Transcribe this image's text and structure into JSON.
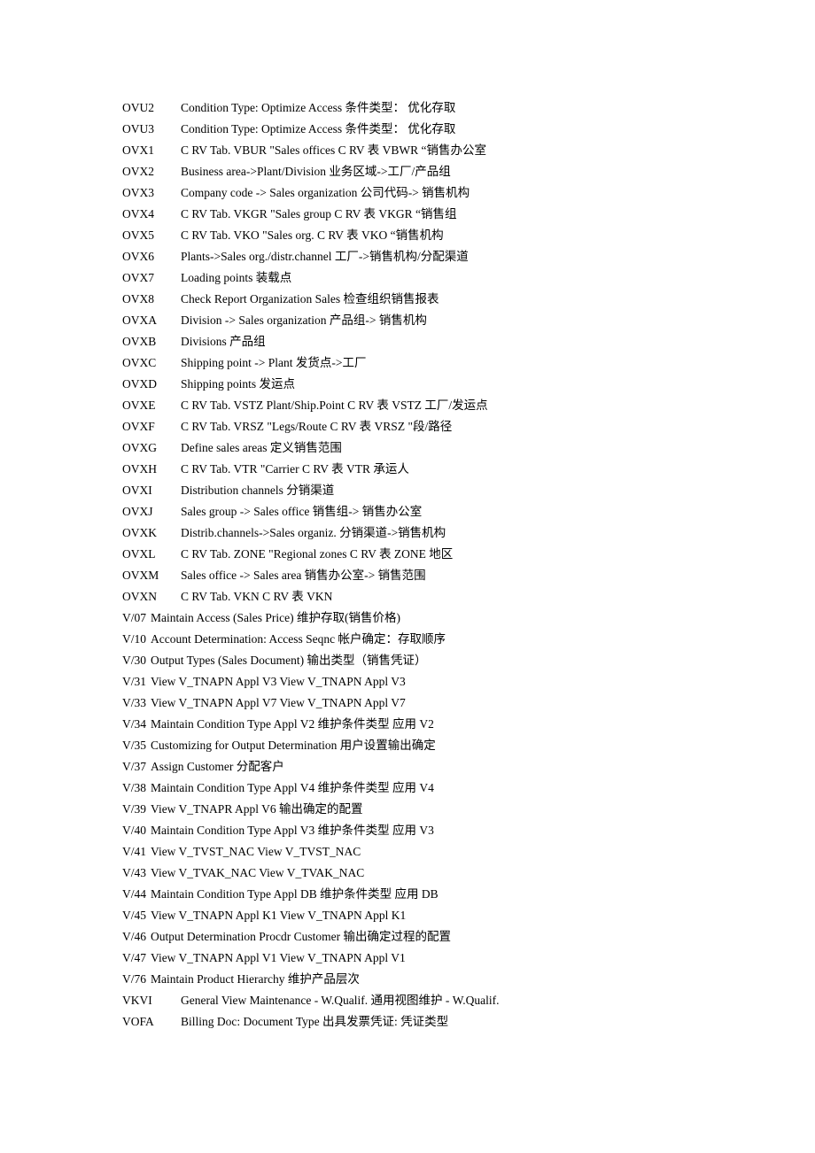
{
  "document": {
    "rows": [
      {
        "code": "OVU2",
        "desc": "Condition Type: Optimize Access  条件类型：  优化存取",
        "layout": "wide"
      },
      {
        "code": "OVU3",
        "desc": "Condition Type: Optimize Access  条件类型：  优化存取",
        "layout": "wide"
      },
      {
        "code": "OVX1",
        "desc": "C RV Tab. VBUR          \"Sales offices C RV  表  VBWR    “销售办公室",
        "layout": "wide"
      },
      {
        "code": "OVX2",
        "desc": "Business area->Plant/Division  业务区域->工厂/产品组",
        "layout": "wide"
      },
      {
        "code": "OVX3",
        "desc": "Company code -> Sales organization  公司代码->  销售机构",
        "layout": "wide"
      },
      {
        "code": "OVX4",
        "desc": "C RV Tab. VKGR          \"Sales group C RV  表  VKGR    “销售组",
        "layout": "wide"
      },
      {
        "code": "OVX5",
        "desc": "C RV Tab. VKO           \"Sales org. C RV  表  VKO        “销售机构",
        "layout": "wide"
      },
      {
        "code": "OVX6",
        "desc": "Plants->Sales org./distr.channel  工厂->销售机构/分配渠道",
        "layout": "wide"
      },
      {
        "code": "OVX7",
        "desc": "Loading points  装载点",
        "layout": "wide"
      },
      {
        "code": "OVX8",
        "desc": "Check Report Organization Sales  检查组织销售报表",
        "layout": "wide"
      },
      {
        "code": "OVXA",
        "desc": "Division -> Sales organization  产品组->  销售机构",
        "layout": "wide"
      },
      {
        "code": "OVXB",
        "desc": "Divisions  产品组",
        "layout": "wide"
      },
      {
        "code": "OVXC",
        "desc": "Shipping point -> Plant  发货点->工厂",
        "layout": "wide"
      },
      {
        "code": "OVXD",
        "desc": "Shipping points  发运点",
        "layout": "wide"
      },
      {
        "code": "OVXE",
        "desc": "C RV Tab. VSTZ          Plant/Ship.Point C RV  表  VSTZ     工厂/发运点",
        "layout": "wide"
      },
      {
        "code": "OVXF",
        "desc": "C RV Tab. VRSZ          \"Legs/Route C RV  表  VRSZ     \"段/路径",
        "layout": "wide"
      },
      {
        "code": "OVXG",
        "desc": "Define sales areas  定义销售范围",
        "layout": "wide"
      },
      {
        "code": "OVXH",
        "desc": "C RV Tab. VTR           \"Carrier C RV  表  VTR        承运人",
        "layout": "wide"
      },
      {
        "code": "OVXI",
        "desc": "Distribution channels  分销渠道",
        "layout": "wide"
      },
      {
        "code": "OVXJ",
        "desc": "Sales group -> Sales office  销售组->  销售办公室",
        "layout": "wide"
      },
      {
        "code": "OVXK",
        "desc": "Distrib.channels->Sales organiz.  分销渠道->销售机构",
        "layout": "wide"
      },
      {
        "code": "OVXL",
        "desc": "C RV Tab. ZONE          \"Regional zones C RV  表  ZONE      地区",
        "layout": "wide"
      },
      {
        "code": "OVXM",
        "desc": "Sales office -> Sales area  销售办公室->  销售范围",
        "layout": "wide"
      },
      {
        "code": "OVXN",
        "desc": "C RV Tab. VKN C RV  表  VKN",
        "layout": "wide"
      },
      {
        "code": "V/07",
        "desc": "Maintain Access (Sales Price)  维护存取(销售价格)",
        "layout": "narrow"
      },
      {
        "code": "V/10",
        "desc": "Account Determination: Access Seqnc  帐户确定：存取顺序",
        "layout": "narrow"
      },
      {
        "code": "V/30",
        "desc": "Output Types (Sales Document)  输出类型（销售凭证）",
        "layout": "narrow"
      },
      {
        "code": "V/31",
        "desc": "View V_TNAPN Appl V3 View V_TNAPN Appl V3",
        "layout": "narrow"
      },
      {
        "code": "V/33",
        "desc": "View V_TNAPN Appl V7 View V_TNAPN Appl V7",
        "layout": "narrow"
      },
      {
        "code": "V/34",
        "desc": "Maintain Condition Type Appl V2  维护条件类型  应用  V2",
        "layout": "narrow"
      },
      {
        "code": "V/35",
        "desc": "Customizing for Output Determination  用户设置输出确定",
        "layout": "narrow"
      },
      {
        "code": "V/37",
        "desc": "Assign Customer  分配客户",
        "layout": "narrow"
      },
      {
        "code": "V/38",
        "desc": "Maintain Condition Type Appl V4  维护条件类型  应用  V4",
        "layout": "narrow"
      },
      {
        "code": "V/39",
        "desc": "View V_TNAPR Appl V6  输出确定的配置",
        "layout": "narrow"
      },
      {
        "code": "V/40",
        "desc": "Maintain Condition Type Appl V3  维护条件类型  应用  V3",
        "layout": "narrow"
      },
      {
        "code": "V/41",
        "desc": "View V_TVST_NAC View V_TVST_NAC",
        "layout": "narrow"
      },
      {
        "code": "V/43",
        "desc": "View V_TVAK_NAC View V_TVAK_NAC",
        "layout": "narrow"
      },
      {
        "code": "V/44",
        "desc": "Maintain Condition Type Appl DB  维护条件类型  应用  DB",
        "layout": "narrow"
      },
      {
        "code": "V/45",
        "desc": "View V_TNAPN Appl K1 View V_TNAPN Appl K1",
        "layout": "narrow"
      },
      {
        "code": "V/46",
        "desc": "Output Determination Procdr Customer  输出确定过程的配置",
        "layout": "narrow"
      },
      {
        "code": "V/47",
        "desc": "View V_TNAPN Appl V1 View V_TNAPN Appl V1",
        "layout": "narrow"
      },
      {
        "code": "V/76",
        "desc": "Maintain Product Hierarchy  维护产品层次",
        "layout": "narrow"
      },
      {
        "code": "VKVI",
        "desc": "General View Maintenance - W.Qualif.  通用视图维护 - W.Qualif.",
        "layout": "wide"
      },
      {
        "code": "VOFA",
        "desc": "Billing Doc: Document Type  出具发票凭证: 凭证类型",
        "layout": "wide"
      }
    ]
  }
}
